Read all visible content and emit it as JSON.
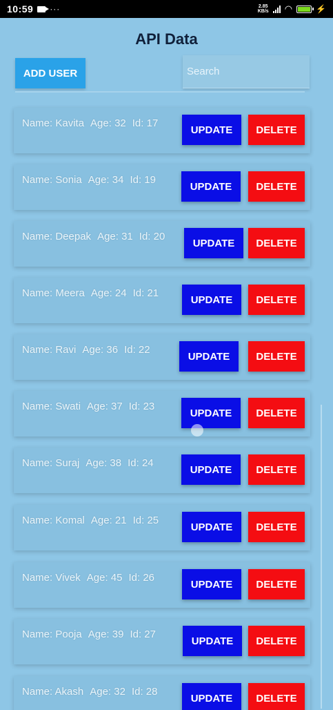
{
  "status_bar": {
    "time": "10:59",
    "dots": "···",
    "net_speed_top": "2.85",
    "net_speed_bottom": "KB/s",
    "icons": [
      "camera-icon",
      "signal-icon",
      "wifi-icon",
      "battery-icon",
      "charging-icon"
    ]
  },
  "header": {
    "title": "API Data",
    "add_user_label": "ADD USER",
    "search_placeholder": "Search"
  },
  "colors": {
    "background": "#8ec6e6",
    "update": "#0a0ee6",
    "delete": "#f40d12",
    "add_user": "#2aa2e8"
  },
  "users": [
    {
      "name": "Name: Kavita",
      "age": "Age: 32",
      "id": "Id: 17",
      "update_label": "UPDATE",
      "delete_label": "DELETE"
    },
    {
      "name": "Name: Sonia",
      "age": "Age: 34",
      "id": "Id: 19",
      "update_label": "UPDATE",
      "delete_label": "DELETE"
    },
    {
      "name": "Name: Deepak",
      "age": "Age: 31",
      "id": "Id: 20",
      "update_label": "UPDATE",
      "delete_label": "DELETE"
    },
    {
      "name": "Name: Meera",
      "age": "Age: 24",
      "id": "Id: 21",
      "update_label": "UPDATE",
      "delete_label": "DELETE"
    },
    {
      "name": "Name: Ravi",
      "age": "Age: 36",
      "id": "Id: 22",
      "update_label": "UPDATE",
      "delete_label": "DELETE"
    },
    {
      "name": "Name: Swati",
      "age": "Age: 37",
      "id": "Id: 23",
      "update_label": "UPDATE",
      "delete_label": "DELETE"
    },
    {
      "name": "Name: Suraj",
      "age": "Age: 38",
      "id": "Id: 24",
      "update_label": "UPDATE",
      "delete_label": "DELETE"
    },
    {
      "name": "Name: Komal",
      "age": "Age: 21",
      "id": "Id: 25",
      "update_label": "UPDATE",
      "delete_label": "DELETE"
    },
    {
      "name": "Name: Vivek",
      "age": "Age: 45",
      "id": "Id: 26",
      "update_label": "UPDATE",
      "delete_label": "DELETE"
    },
    {
      "name": "Name: Pooja",
      "age": "Age: 39",
      "id": "Id: 27",
      "update_label": "UPDATE",
      "delete_label": "DELETE"
    },
    {
      "name": "Name: Akash",
      "age": "Age: 32",
      "id": "Id: 28",
      "update_label": "UPDATE",
      "delete_label": "DELETE"
    }
  ]
}
